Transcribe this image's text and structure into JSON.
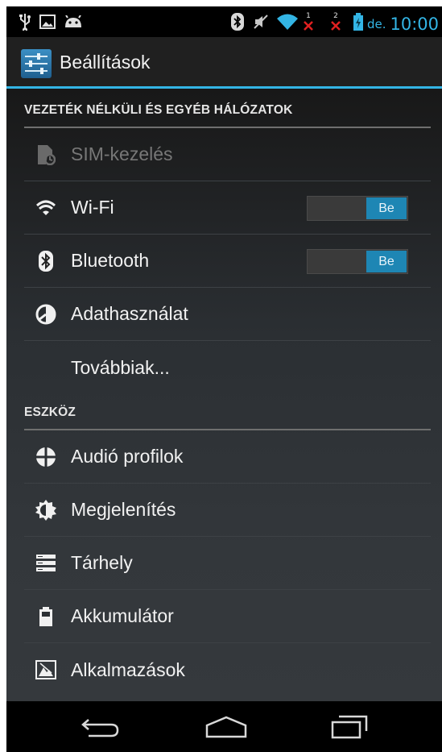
{
  "status_bar": {
    "icons": [
      "usb-icon",
      "image-icon",
      "android-debug-icon",
      "bluetooth-icon",
      "mute-icon",
      "wifi-icon",
      "sim1-no-signal-icon",
      "sim2-no-signal-icon",
      "battery-charging-icon"
    ],
    "sim1_number": "1",
    "sim2_number": "2",
    "ampm": "de.",
    "time": "10:00",
    "accent_color": "#33b5e5"
  },
  "action_bar": {
    "icon": "settings-sliders-icon",
    "title": "Beállítások"
  },
  "sections": {
    "wireless": {
      "header": "VEZETÉK NÉLKÜLI ÉS EGYÉB HÁLÓZATOK",
      "items": [
        {
          "label": "SIM-kezelés",
          "icon": "sim-management-icon",
          "enabled": false
        },
        {
          "label": "Wi-Fi",
          "icon": "wifi-icon",
          "toggle": "Be"
        },
        {
          "label": "Bluetooth",
          "icon": "bluetooth-icon",
          "toggle": "Be"
        },
        {
          "label": "Adathasználat",
          "icon": "data-usage-icon"
        },
        {
          "label": "Továbbiak...",
          "icon": ""
        }
      ]
    },
    "device": {
      "header": "ESZKÖZ",
      "items": [
        {
          "label": "Audió profilok",
          "icon": "audio-profiles-icon"
        },
        {
          "label": "Megjelenítés",
          "icon": "display-icon"
        },
        {
          "label": "Tárhely",
          "icon": "storage-icon"
        },
        {
          "label": "Akkumulátor",
          "icon": "battery-icon"
        },
        {
          "label": "Alkalmazások",
          "icon": "apps-icon"
        }
      ]
    }
  },
  "nav_bar": {
    "buttons": [
      "back-icon",
      "home-icon",
      "recents-icon"
    ]
  }
}
